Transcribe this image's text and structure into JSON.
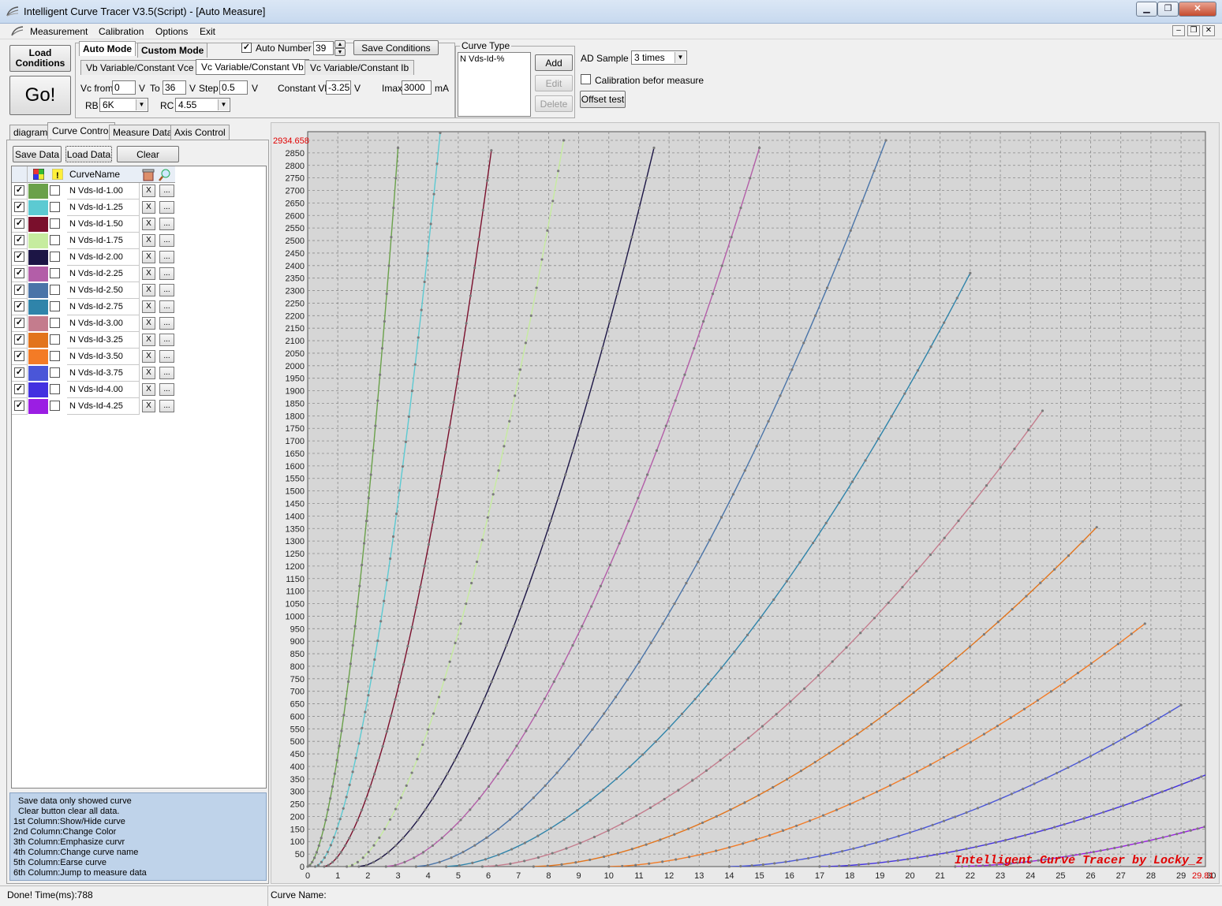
{
  "window": {
    "title": "Intelligent Curve Tracer V3.5(Script) - [Auto Measure]"
  },
  "menu": [
    "Measurement",
    "Calibration",
    "Options",
    "Exit"
  ],
  "toolbar": {
    "load_conditions": "Load\nConditions",
    "go": "Go!",
    "auto_mode": "Auto Mode",
    "custom_mode": "Custom Mode",
    "auto_number_label": "Auto Number",
    "auto_number_checked": true,
    "auto_number_value": "39",
    "save_conditions": "Save Conditions",
    "mode_tabs": [
      "Vb Variable/Constant Vce",
      "Vc Variable/Constant Vb",
      "Vc Variable/Constant Ib"
    ],
    "vc_from_label": "Vc from",
    "vc_from_value": "0",
    "vc_to_label": "To",
    "vc_to_value": "36",
    "step_label": "Step",
    "step_value": "0.5",
    "v_unit": "V",
    "constant_vb_label": "Constant Vb",
    "constant_vb_value": "-3.25",
    "imax_label": "Imax",
    "imax_value": "3000",
    "ma_unit": "mA",
    "rb_label": "RB",
    "rb_value": "6K",
    "rc_label": "RC",
    "rc_value": "4.55"
  },
  "curve_type": {
    "legend": "Curve Type",
    "items": [
      "N Vds-Id-%"
    ],
    "add": "Add",
    "edit": "Edit",
    "delete": "Delete"
  },
  "ad_sample": {
    "label": "AD Sample",
    "value": "3 times",
    "calibration_label": "Calibration befor measure",
    "calibration_checked": false,
    "offset_test": "Offset test"
  },
  "left_tabs": [
    "diagram",
    "Curve Control",
    "Measure Data",
    "Axis Control"
  ],
  "curve_control": {
    "save_data": "Save Data",
    "load_data": "Load Data",
    "clear": "Clear",
    "header_name": "CurveName",
    "x_label": "X",
    "more_label": "...",
    "curves": [
      {
        "name": "N Vds-Id-1.00",
        "color": "#6aa14a",
        "show": true
      },
      {
        "name": "N Vds-Id-1.25",
        "color": "#5ccad2",
        "show": true
      },
      {
        "name": "N Vds-Id-1.50",
        "color": "#7a0f2c",
        "show": true
      },
      {
        "name": "N Vds-Id-1.75",
        "color": "#c6ec9f",
        "show": true
      },
      {
        "name": "N Vds-Id-2.00",
        "color": "#1c1545",
        "show": true
      },
      {
        "name": "N Vds-Id-2.25",
        "color": "#b35ea8",
        "show": true
      },
      {
        "name": "N Vds-Id-2.50",
        "color": "#4a74a8",
        "show": true
      },
      {
        "name": "N Vds-Id-2.75",
        "color": "#2f84aa",
        "show": true
      },
      {
        "name": "N Vds-Id-3.00",
        "color": "#c47c8d",
        "show": true
      },
      {
        "name": "N Vds-Id-3.25",
        "color": "#e2741c",
        "show": true
      },
      {
        "name": "N Vds-Id-3.50",
        "color": "#f37b26",
        "show": true
      },
      {
        "name": "N Vds-Id-3.75",
        "color": "#4a56d8",
        "show": true
      },
      {
        "name": "N Vds-Id-4.00",
        "color": "#4330e0",
        "show": true
      },
      {
        "name": "N Vds-Id-4.25",
        "color": "#9b1ee3",
        "show": true
      }
    ],
    "help": [
      "Save data only showed curve",
      "Clear button clear all data.",
      "1st Column:Show/Hide curve",
      "2nd Column:Change Color",
      "3th Column:Emphasize curvr",
      "4th Column:Change curve name",
      "5th Column:Earse curve",
      "6th Column:Jump to measure data"
    ]
  },
  "status": {
    "left": "Done!  Time(ms):788",
    "right": "Curve Name:"
  },
  "chart_data": {
    "type": "line",
    "xlim": [
      0,
      29.81
    ],
    "ylim": [
      0,
      2934.658
    ],
    "x_ticks": [
      0,
      1,
      2,
      3,
      4,
      5,
      6,
      7,
      8,
      9,
      10,
      11,
      12,
      13,
      14,
      15,
      16,
      17,
      18,
      19,
      20,
      21,
      22,
      23,
      24,
      25,
      26,
      27,
      28,
      29,
      30
    ],
    "y_tick_step": 50,
    "x_max_label": "29.81",
    "y_max_label": "2934.658",
    "watermark": "Intelligent Curve Tracer by Locky_z",
    "grid": true,
    "series": [
      {
        "name": "N Vds-Id-1.00",
        "color": "#6aa14a",
        "x0": 0,
        "x_end": 3.0,
        "y_end": 2870
      },
      {
        "name": "N Vds-Id-1.25",
        "color": "#5ccad2",
        "x0": 0.25,
        "x_end": 4.4,
        "y_end": 2930
      },
      {
        "name": "N Vds-Id-1.50",
        "color": "#7a0f2c",
        "x0": 0.55,
        "x_end": 6.1,
        "y_end": 2860
      },
      {
        "name": "N Vds-Id-1.75",
        "color": "#c6ec9f",
        "x0": 1.3,
        "x_end": 8.5,
        "y_end": 2900
      },
      {
        "name": "N Vds-Id-2.00",
        "color": "#1c1545",
        "x0": 1.7,
        "x_end": 11.5,
        "y_end": 2870
      },
      {
        "name": "N Vds-Id-2.25",
        "color": "#b35ea8",
        "x0": 2.6,
        "x_end": 15.0,
        "y_end": 2870
      },
      {
        "name": "N Vds-Id-2.50",
        "color": "#4a74a8",
        "x0": 3.6,
        "x_end": 19.2,
        "y_end": 2900
      },
      {
        "name": "N Vds-Id-2.75",
        "color": "#2f84aa",
        "x0": 4.6,
        "x_end": 22.0,
        "y_end": 2370
      },
      {
        "name": "N Vds-Id-3.00",
        "color": "#c47c8d",
        "x0": 5.8,
        "x_end": 24.4,
        "y_end": 1820
      },
      {
        "name": "N Vds-Id-3.25",
        "color": "#e2741c",
        "x0": 7.5,
        "x_end": 26.2,
        "y_end": 1355
      },
      {
        "name": "N Vds-Id-3.50",
        "color": "#f37b26",
        "x0": 10.0,
        "x_end": 27.8,
        "y_end": 970
      },
      {
        "name": "N Vds-Id-3.75",
        "color": "#4a56d8",
        "x0": 14.0,
        "x_end": 29.0,
        "y_end": 645
      },
      {
        "name": "N Vds-Id-4.00",
        "color": "#4330e0",
        "x0": 17.0,
        "x_end": 30.0,
        "y_end": 375
      },
      {
        "name": "N Vds-Id-4.25",
        "color": "#9b1ee3",
        "x0": 21.5,
        "x_end": 30.7,
        "y_end": 190
      }
    ]
  }
}
